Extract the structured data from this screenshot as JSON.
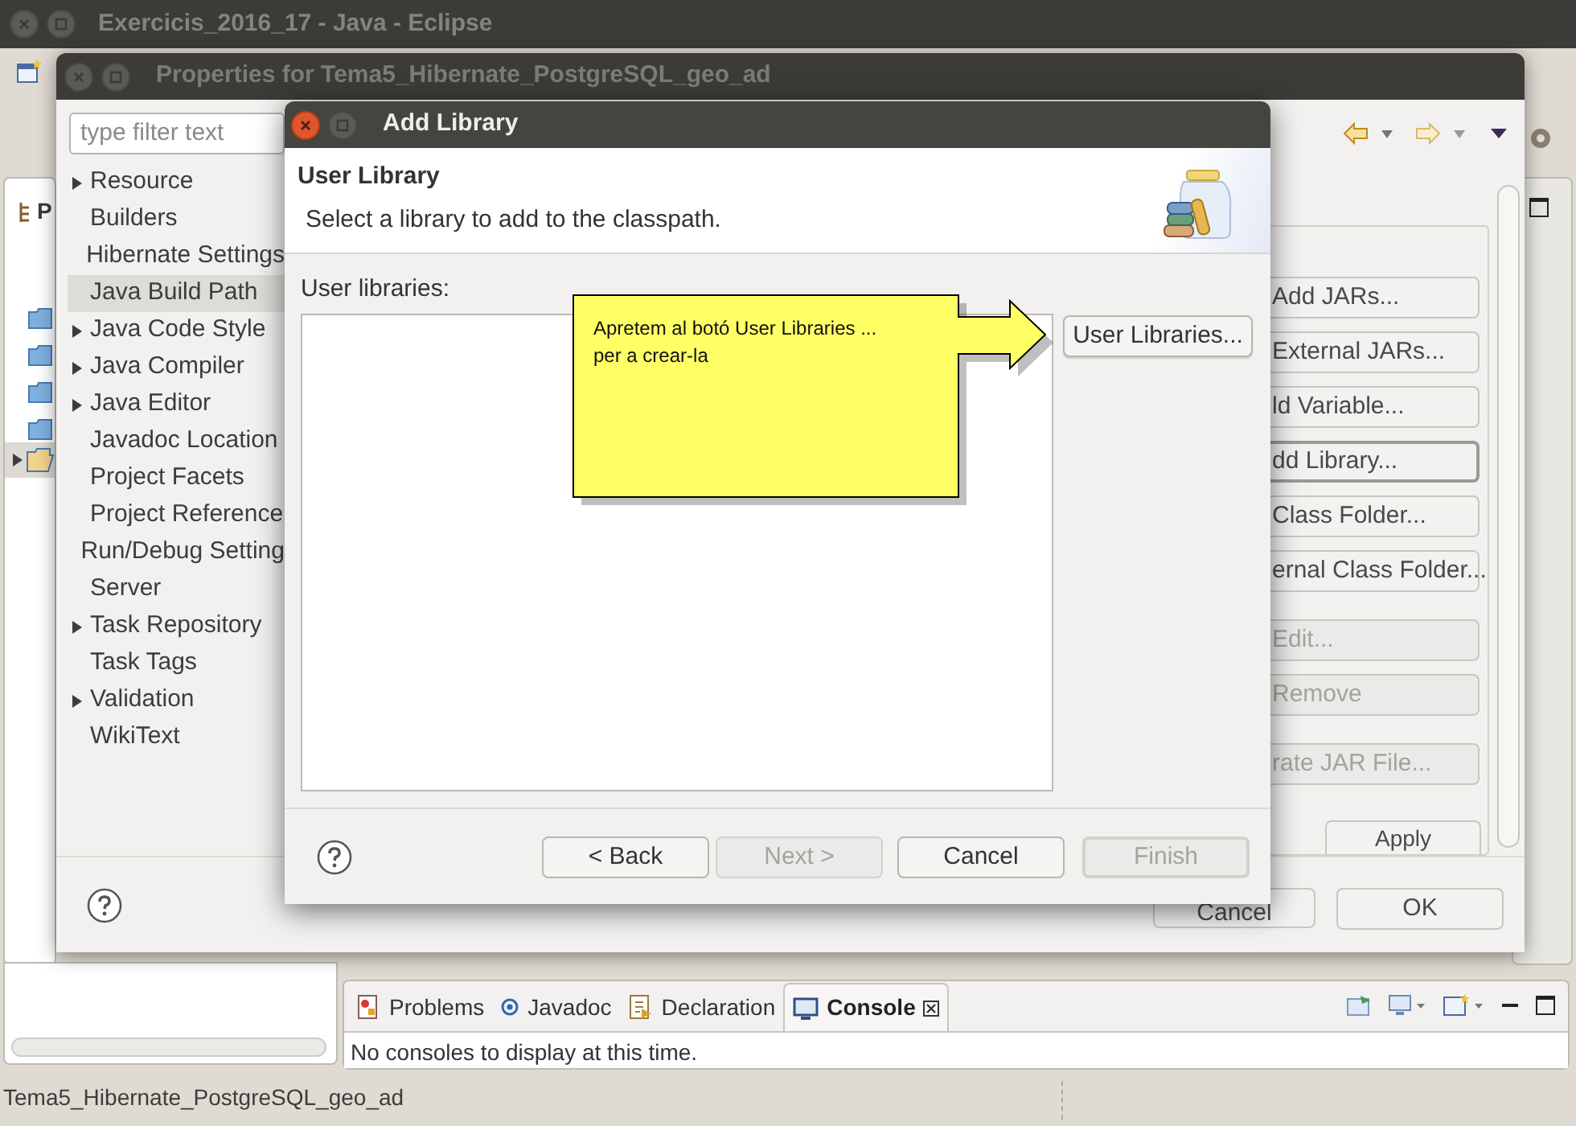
{
  "eclipse": {
    "title": "Exercicis_2016_17 - Java - Eclipse",
    "bottom_tabs": [
      {
        "label": "Problems",
        "selected": false,
        "kind": "problems"
      },
      {
        "label": "Javadoc",
        "selected": false,
        "kind": "javadoc"
      },
      {
        "label": "Declaration",
        "selected": false,
        "kind": "declaration"
      },
      {
        "label": "Console",
        "selected": true,
        "kind": "console"
      }
    ],
    "console_message": "No consoles to display at this time.",
    "explorer_tab": "P",
    "status_bar": "Tema5_Hibernate_PostgreSQL_geo_ad"
  },
  "properties": {
    "title": "Properties for Tema5_Hibernate_PostgreSQL_geo_ad",
    "filter_placeholder": "type filter text",
    "categories": [
      {
        "label": "Resource",
        "has_children": true,
        "selected": false
      },
      {
        "label": "Builders",
        "has_children": false,
        "selected": false
      },
      {
        "label": "Hibernate Settings",
        "has_children": false,
        "selected": false
      },
      {
        "label": "Java Build Path",
        "has_children": false,
        "selected": true
      },
      {
        "label": "Java Code Style",
        "has_children": true,
        "selected": false
      },
      {
        "label": "Java Compiler",
        "has_children": true,
        "selected": false
      },
      {
        "label": "Java Editor",
        "has_children": true,
        "selected": false
      },
      {
        "label": "Javadoc Location",
        "has_children": false,
        "selected": false
      },
      {
        "label": "Project Facets",
        "has_children": false,
        "selected": false
      },
      {
        "label": "Project Reference",
        "has_children": false,
        "selected": false
      },
      {
        "label": "Run/Debug Setting",
        "has_children": false,
        "selected": false
      },
      {
        "label": "Server",
        "has_children": false,
        "selected": false
      },
      {
        "label": "Task Repository",
        "has_children": true,
        "selected": false
      },
      {
        "label": "Task Tags",
        "has_children": false,
        "selected": false
      },
      {
        "label": "Validation",
        "has_children": true,
        "selected": false
      },
      {
        "label": "WikiText",
        "has_children": false,
        "selected": false
      }
    ],
    "side_buttons": [
      {
        "label": "Add JARs...",
        "disabled": false,
        "focused": false
      },
      {
        "label": "External JARs...",
        "disabled": false,
        "focused": false
      },
      {
        "label": "ld Variable...",
        "disabled": false,
        "focused": false
      },
      {
        "label": "dd Library...",
        "disabled": false,
        "focused": true
      },
      {
        "label": "Class Folder...",
        "disabled": false,
        "focused": false
      },
      {
        "label": "ernal Class Folder...",
        "disabled": false,
        "focused": false
      },
      {
        "label": "Edit...",
        "disabled": true,
        "focused": false
      },
      {
        "label": "Remove",
        "disabled": true,
        "focused": false
      },
      {
        "label": "rate JAR File...",
        "disabled": true,
        "focused": false
      }
    ],
    "apply": "Apply",
    "cancel": "Cancel",
    "ok": "OK"
  },
  "add_library": {
    "title": "Add Library",
    "heading": "User Library",
    "description": "Select a library to add to the classpath.",
    "list_label": "User libraries:",
    "user_libraries_button": "User Libraries...",
    "buttons": [
      {
        "label": "< Back",
        "disabled": false
      },
      {
        "label": "Next >",
        "disabled": true
      },
      {
        "label": "Cancel",
        "disabled": false
      },
      {
        "label": "Finish",
        "disabled": true
      }
    ]
  },
  "callout": {
    "text_lines": [
      "Apretem al botó User Libraries ...",
      "per a crear-la"
    ]
  }
}
